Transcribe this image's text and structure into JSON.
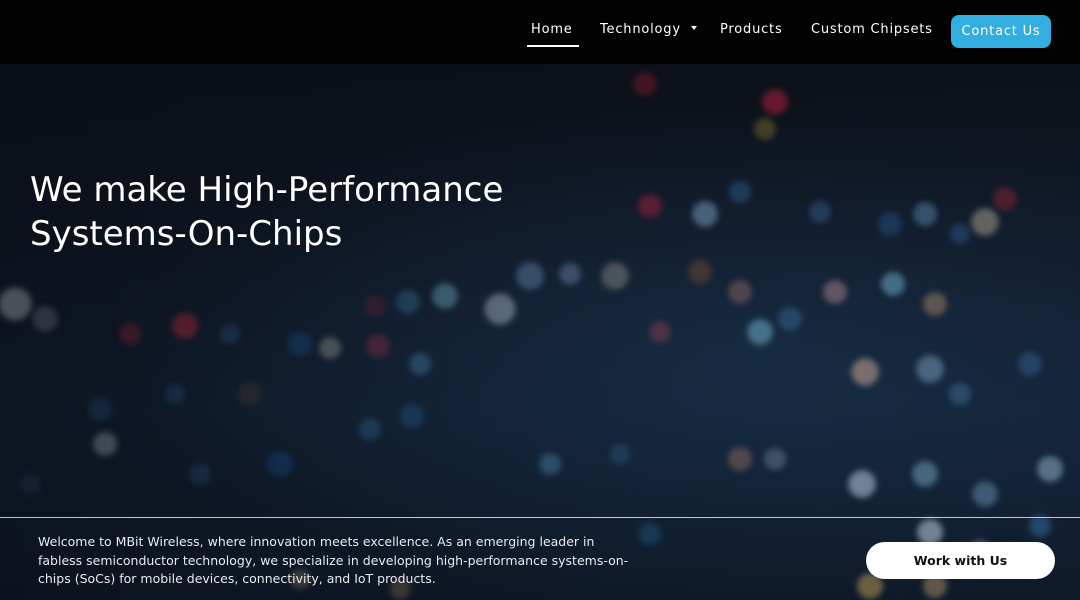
{
  "nav": {
    "items": [
      {
        "label": "Home",
        "active": true
      },
      {
        "label": "Technology",
        "has_dropdown": true
      },
      {
        "label": "Products"
      },
      {
        "label": "Custom Chipsets"
      }
    ],
    "contact_label": "Contact Us",
    "accent_color": "#33aee0"
  },
  "hero": {
    "title_line1": "We make High-Performance",
    "title_line2": "Systems-On-Chips",
    "intro": "Welcome to MBit Wireless, where innovation meets excellence. As an emerging leader in fabless semiconductor technology, we specialize in developing high-performance systems-on-chips (SoCs) for mobile devices, connectivity, and IoT products.",
    "cta_label": "Work with Us",
    "background": "blurred city lights at night (bokeh)"
  }
}
